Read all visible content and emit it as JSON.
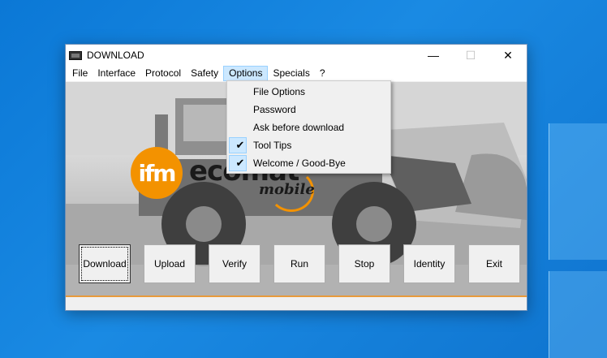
{
  "window": {
    "title": "DOWNLOAD",
    "minimize": "—",
    "maximize": "☐",
    "close": "✕"
  },
  "menu": [
    "File",
    "Interface",
    "Protocol",
    "Safety",
    "Options",
    "Specials",
    "?"
  ],
  "options_menu": {
    "items": [
      {
        "label": "File Options",
        "checked": false
      },
      {
        "label": "Password",
        "checked": false
      },
      {
        "label": "Ask before download",
        "checked": false
      },
      {
        "label": "Tool Tips",
        "checked": true
      },
      {
        "label": "Welcome / Good-Bye",
        "checked": true
      }
    ],
    "check_glyph": "✔"
  },
  "branding": {
    "logo": "ifm",
    "product": "ecomat",
    "product_sub": "mobile"
  },
  "buttons": [
    "Download",
    "Upload",
    "Verify",
    "Run",
    "Stop",
    "Identity",
    "Exit"
  ],
  "colors": {
    "accent": "#f39200",
    "menu_highlight": "#cce8ff",
    "desktop": "#0b78d6"
  }
}
